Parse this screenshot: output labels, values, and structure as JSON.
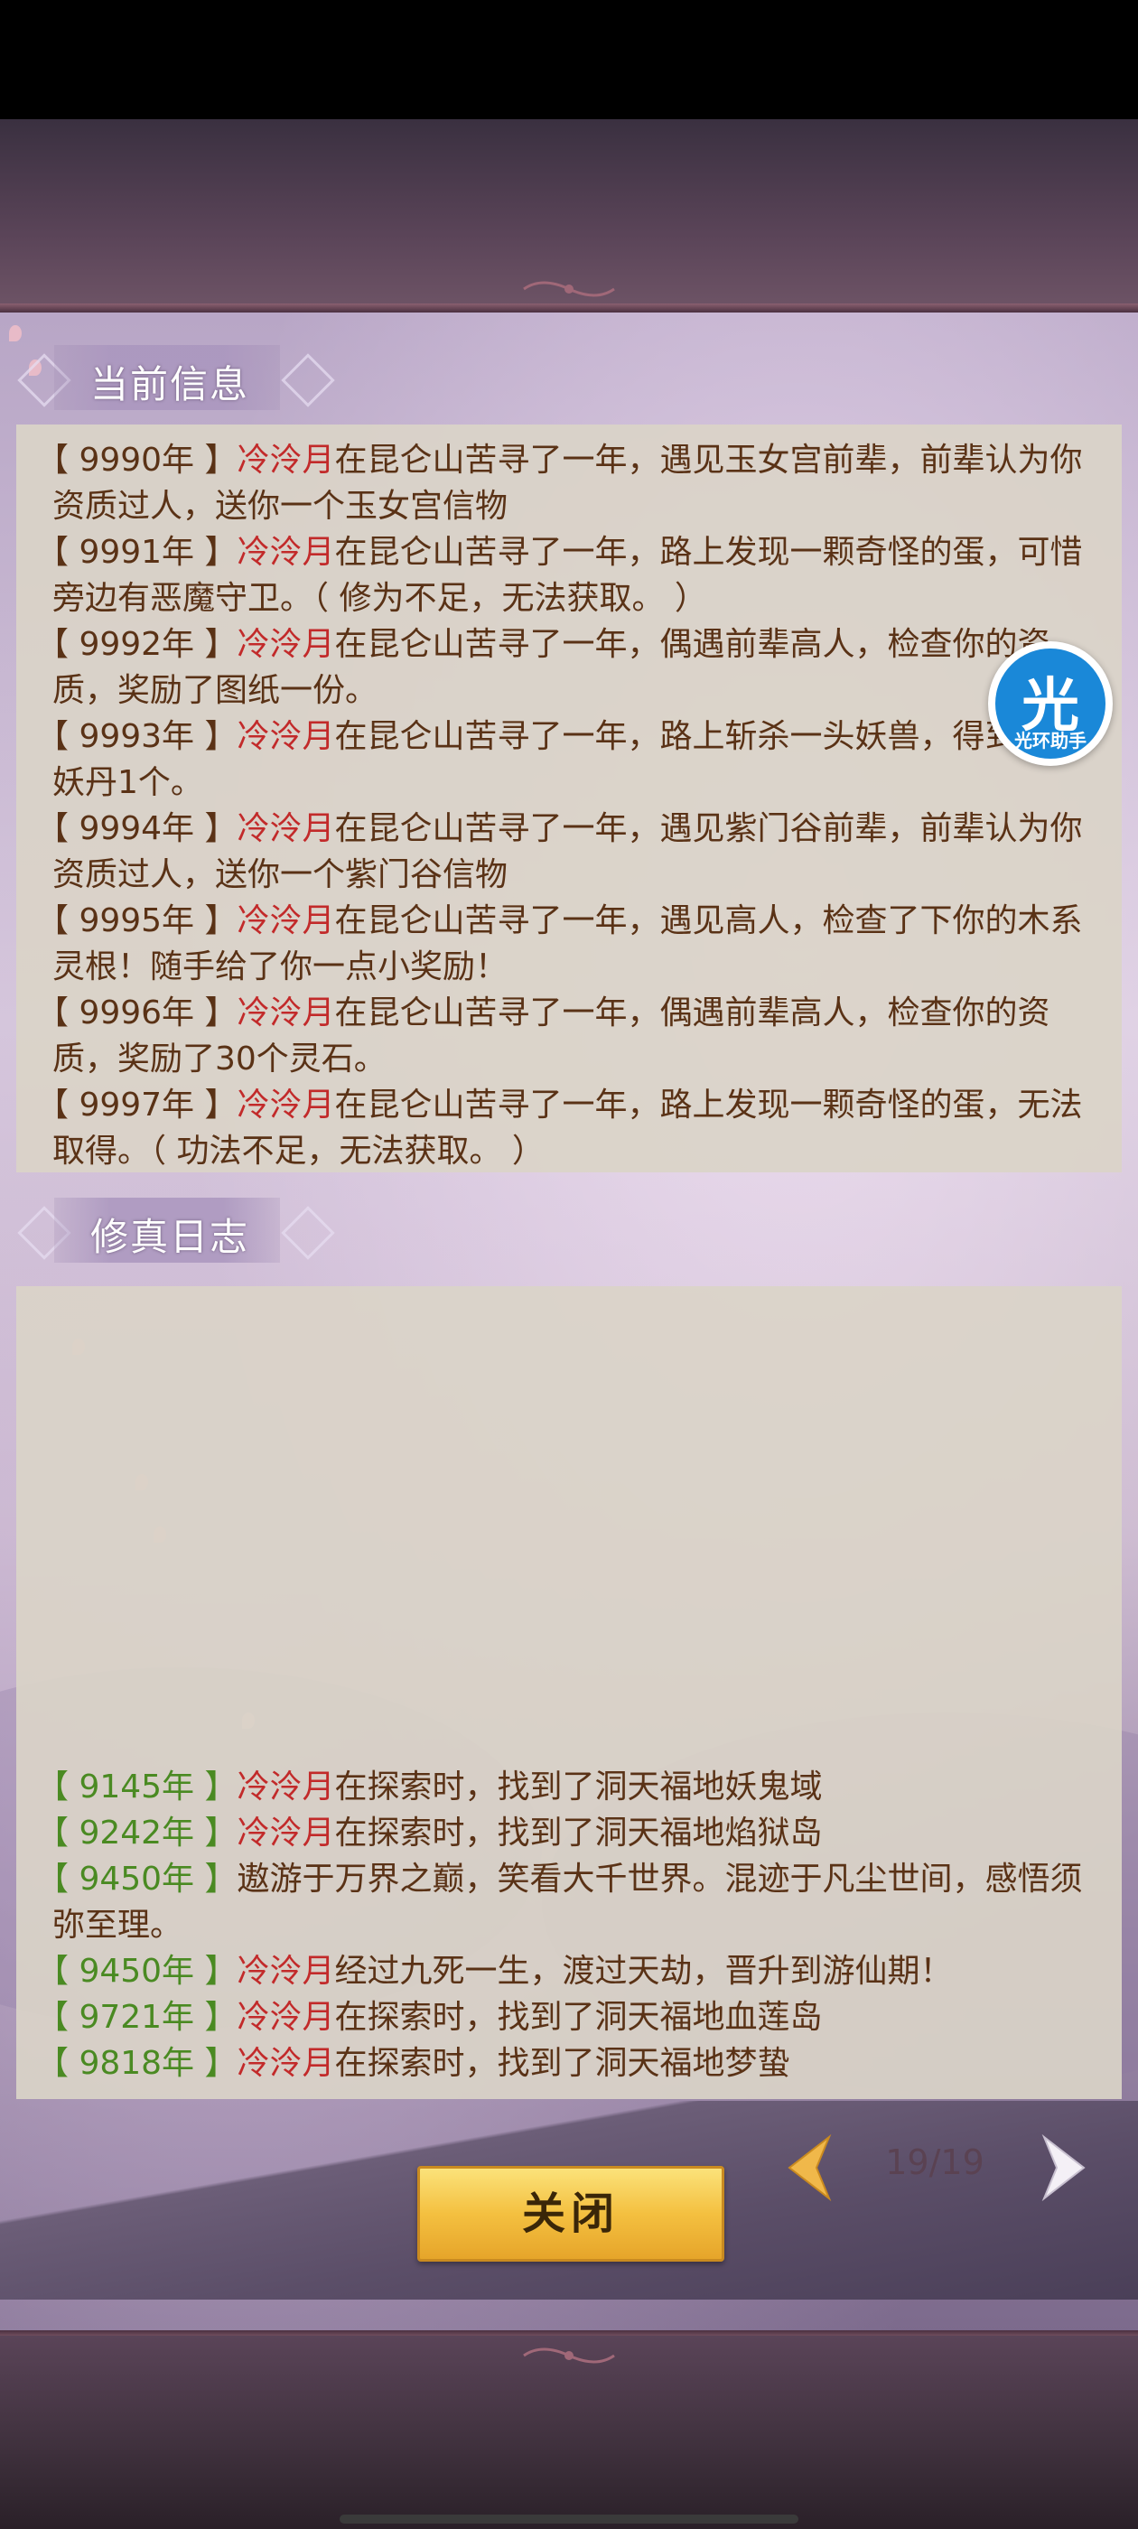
{
  "current_info": {
    "title": "当前信息",
    "entries": [
      {
        "year": "【 9990年 】",
        "name": "冷泠月",
        "text": "在昆仑山苦寻了一年，遇见玉女宫前辈，前辈认为你资质过人，送你一个玉女宫信物"
      },
      {
        "year": "【 9991年 】",
        "name": "冷泠月",
        "text": "在昆仑山苦寻了一年，路上发现一颗奇怪的蛋，可惜旁边有恶魔守卫。（ 修为不足，无法获取。 ）"
      },
      {
        "year": "【 9992年 】",
        "name": "冷泠月",
        "text": "在昆仑山苦寻了一年，偶遇前辈高人，检查你的资质，奖励了图纸一份。"
      },
      {
        "year": "【 9993年 】",
        "name": "冷泠月",
        "text": "在昆仑山苦寻了一年，路上斩杀一头妖兽，得到劣质妖丹1个。"
      },
      {
        "year": "【 9994年 】",
        "name": "冷泠月",
        "text": "在昆仑山苦寻了一年，遇见紫门谷前辈，前辈认为你资质过人，送你一个紫门谷信物"
      },
      {
        "year": "【 9995年 】",
        "name": "冷泠月",
        "text": "在昆仑山苦寻了一年，遇见高人，检查了下你的木系灵根！随手给了你一点小奖励！"
      },
      {
        "year": "【 9996年 】",
        "name": "冷泠月",
        "text": "在昆仑山苦寻了一年，偶遇前辈高人，检查你的资质，奖励了30个灵石。"
      },
      {
        "year": "【 9997年 】",
        "name": "冷泠月",
        "text": "在昆仑山苦寻了一年，路上发现一颗奇怪的蛋，无法取得。（ 功法不足，无法获取。 ）"
      }
    ]
  },
  "cultivation_log": {
    "title": "修真日志",
    "entries": [
      {
        "year": "【 9145年 】",
        "name": "冷泠月",
        "text": "在探索时，找到了洞天福地妖鬼域"
      },
      {
        "year": "【 9242年 】",
        "name": "冷泠月",
        "text": "在探索时，找到了洞天福地焰狱岛"
      },
      {
        "year": "【 9450年 】",
        "name": "",
        "text": "遨游于万界之巅，笑看大千世界。混迹于凡尘世间，感悟须弥至理。"
      },
      {
        "year": "【 9450年 】",
        "name": "冷泠月",
        "text": "经过九死一生，渡过天劫，晋升到游仙期！"
      },
      {
        "year": "【 9721年 】",
        "name": "冷泠月",
        "text": "在探索时，找到了洞天福地血莲岛"
      },
      {
        "year": "【 9818年 】",
        "name": "冷泠月",
        "text": "在探索时，找到了洞天福地梦蛰"
      }
    ]
  },
  "badge": {
    "glyph": "光",
    "caption": "光环助手"
  },
  "footer": {
    "close_label": "关闭",
    "page": "19/19"
  },
  "colors": {
    "name": "#c22a2a",
    "year_log": "#4a8a22",
    "text": "#5a3216",
    "button": "#f4c040"
  }
}
